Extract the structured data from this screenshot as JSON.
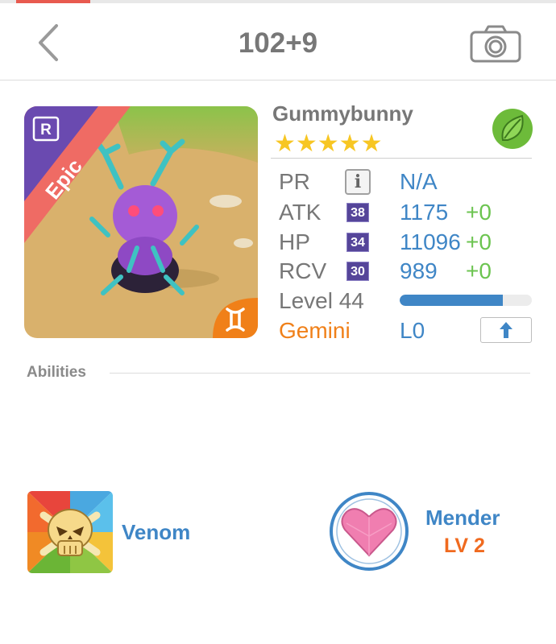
{
  "header": {
    "title": "102+9",
    "back_icon": "chevron-left-icon",
    "camera_icon": "camera-icon"
  },
  "monster": {
    "name": "Gummybunny",
    "rarity": "Epic",
    "rarity_badge": "R",
    "star_count": 5,
    "stars": "★★★★★",
    "element": "leaf-icon",
    "zodiac_icon": "gemini-icon"
  },
  "stats": {
    "pr": {
      "label": "PR",
      "value": "N/A"
    },
    "atk": {
      "label": "ATK",
      "badge": "38",
      "value": "1175",
      "plus": "+0"
    },
    "hp": {
      "label": "HP",
      "badge": "34",
      "value": "11096",
      "plus": "+0"
    },
    "rcv": {
      "label": "RCV",
      "badge": "30",
      "value": "989",
      "plus": "+0"
    },
    "level": {
      "label": "Level 44",
      "progress": 0.78
    },
    "zodiac": {
      "label": "Gemini",
      "value": "L0"
    }
  },
  "abilities": {
    "section_label": "Abilities",
    "items": [
      {
        "name": "Venom",
        "icon": "skull-icon"
      },
      {
        "name": "Mender",
        "level": "LV 2",
        "icon": "heart-icon"
      }
    ]
  },
  "colors": {
    "accent_blue": "#3f86c6",
    "plus_green": "#6cc450",
    "zodiac_orange": "#f08019",
    "star_yellow": "#f7c623",
    "epic_red": "#ef6b64",
    "badge_purple": "#554599"
  }
}
